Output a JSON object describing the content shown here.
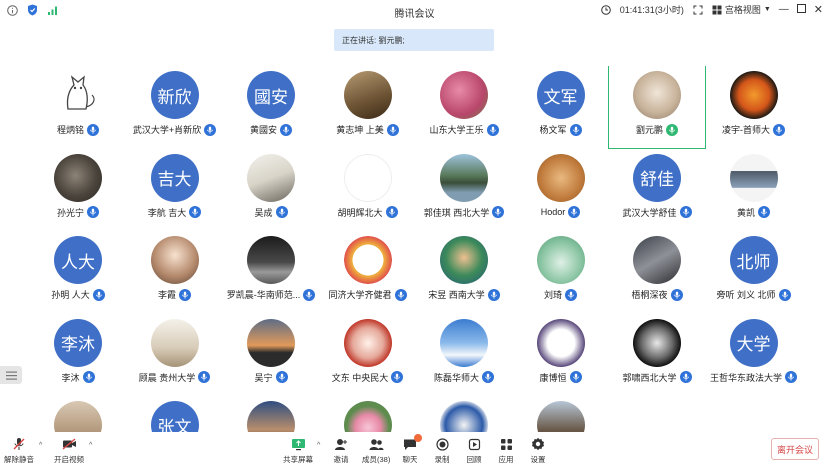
{
  "window": {
    "title": "腾讯会议",
    "timer": "01:41:31(3小时)",
    "view_mode": "宫格视图"
  },
  "speaking_banner": "正在讲话: 劉元鹏;",
  "participants": [
    {
      "name": "程炳铭",
      "avatar_text": "",
      "avatar_kind": "cat-sketch"
    },
    {
      "name": "武汉大学+肖新欣",
      "avatar_text": "新欣",
      "avatar_kind": "text"
    },
    {
      "name": "黄國安",
      "avatar_text": "國安",
      "avatar_kind": "text"
    },
    {
      "name": "黄志坤 上美",
      "avatar_text": "",
      "avatar_kind": "photo-brown"
    },
    {
      "name": "山东大学王乐",
      "avatar_text": "",
      "avatar_kind": "photo-pink"
    },
    {
      "name": "杨文军",
      "avatar_text": "文军",
      "avatar_kind": "text"
    },
    {
      "name": "劉元鹏",
      "avatar_text": "",
      "avatar_kind": "photo-cat",
      "active": true
    },
    {
      "name": "凌宇-首师大",
      "avatar_text": "",
      "avatar_kind": "photo-flower-orange"
    },
    {
      "name": "孙光宁",
      "avatar_text": "",
      "avatar_kind": "photo-dark"
    },
    {
      "name": "李航 吉大",
      "avatar_text": "吉大",
      "avatar_kind": "text"
    },
    {
      "name": "吴成",
      "avatar_text": "",
      "avatar_kind": "photo-sketch"
    },
    {
      "name": "胡明辉北大",
      "avatar_text": "",
      "avatar_kind": "blank"
    },
    {
      "name": "郭佳琪 西北大学",
      "avatar_text": "",
      "avatar_kind": "photo-lake"
    },
    {
      "name": "Hodor",
      "avatar_text": "",
      "avatar_kind": "photo-dog"
    },
    {
      "name": "武汉大学舒佳",
      "avatar_text": "舒佳",
      "avatar_kind": "text"
    },
    {
      "name": "黄凯",
      "avatar_text": "",
      "avatar_kind": "photo-man"
    },
    {
      "name": "孙明 人大",
      "avatar_text": "人大",
      "avatar_kind": "text"
    },
    {
      "name": "李霞",
      "avatar_text": "",
      "avatar_kind": "photo-anime"
    },
    {
      "name": "罗凯晨-华南师范...",
      "avatar_text": "",
      "avatar_kind": "photo-moon"
    },
    {
      "name": "同济大学齐健君",
      "avatar_text": "",
      "avatar_kind": "photo-cartoon"
    },
    {
      "name": "宋昱 西南大学",
      "avatar_text": "",
      "avatar_kind": "photo-anime-green"
    },
    {
      "name": "刘琦",
      "avatar_text": "",
      "avatar_kind": "photo-chart"
    },
    {
      "name": "梧桐深夜",
      "avatar_text": "",
      "avatar_kind": "photo-hand"
    },
    {
      "name": "旁听 刘义 北师",
      "avatar_text": "北师",
      "avatar_kind": "text"
    },
    {
      "name": "李沐",
      "avatar_text": "李沐",
      "avatar_kind": "text"
    },
    {
      "name": "顾晨 贵州大学",
      "avatar_text": "",
      "avatar_kind": "photo-light"
    },
    {
      "name": "吴宁",
      "avatar_text": "",
      "avatar_kind": "photo-sunset"
    },
    {
      "name": "文东 中央民大",
      "avatar_text": "",
      "avatar_kind": "photo-seal"
    },
    {
      "name": "陈磊华师大",
      "avatar_text": "",
      "avatar_kind": "photo-sky"
    },
    {
      "name": "康博恒",
      "avatar_text": "",
      "avatar_kind": "photo-rabbit"
    },
    {
      "name": "郭啸西北大学",
      "avatar_text": "",
      "avatar_kind": "photo-bw-girl"
    },
    {
      "name": "王哲华东政法大学",
      "avatar_text": "大学",
      "avatar_kind": "text"
    },
    {
      "name": "",
      "avatar_text": "",
      "avatar_kind": "photo-cat2"
    },
    {
      "name": "",
      "avatar_text": "张文",
      "avatar_kind": "text"
    },
    {
      "name": "",
      "avatar_text": "",
      "avatar_kind": "photo-man2"
    },
    {
      "name": "",
      "avatar_text": "",
      "avatar_kind": "photo-lotus"
    },
    {
      "name": "",
      "avatar_text": "",
      "avatar_kind": "photo-badge"
    },
    {
      "name": "",
      "avatar_text": "",
      "avatar_kind": "photo-building"
    }
  ],
  "toolbar": {
    "mute": "解除静音",
    "video": "开启视频",
    "share": "共享屏幕",
    "invite": "邀请",
    "members": "成员(38)",
    "chat": "聊天",
    "record": "录制",
    "rewind": "回顾",
    "apps": "应用",
    "settings": "设置",
    "leave": "离开会议"
  },
  "colors": {
    "text_avatar": "#3f6fc6",
    "mic_blue": "#2f72d8",
    "active_green": "#2eb872",
    "leave_red": "#d64545"
  }
}
